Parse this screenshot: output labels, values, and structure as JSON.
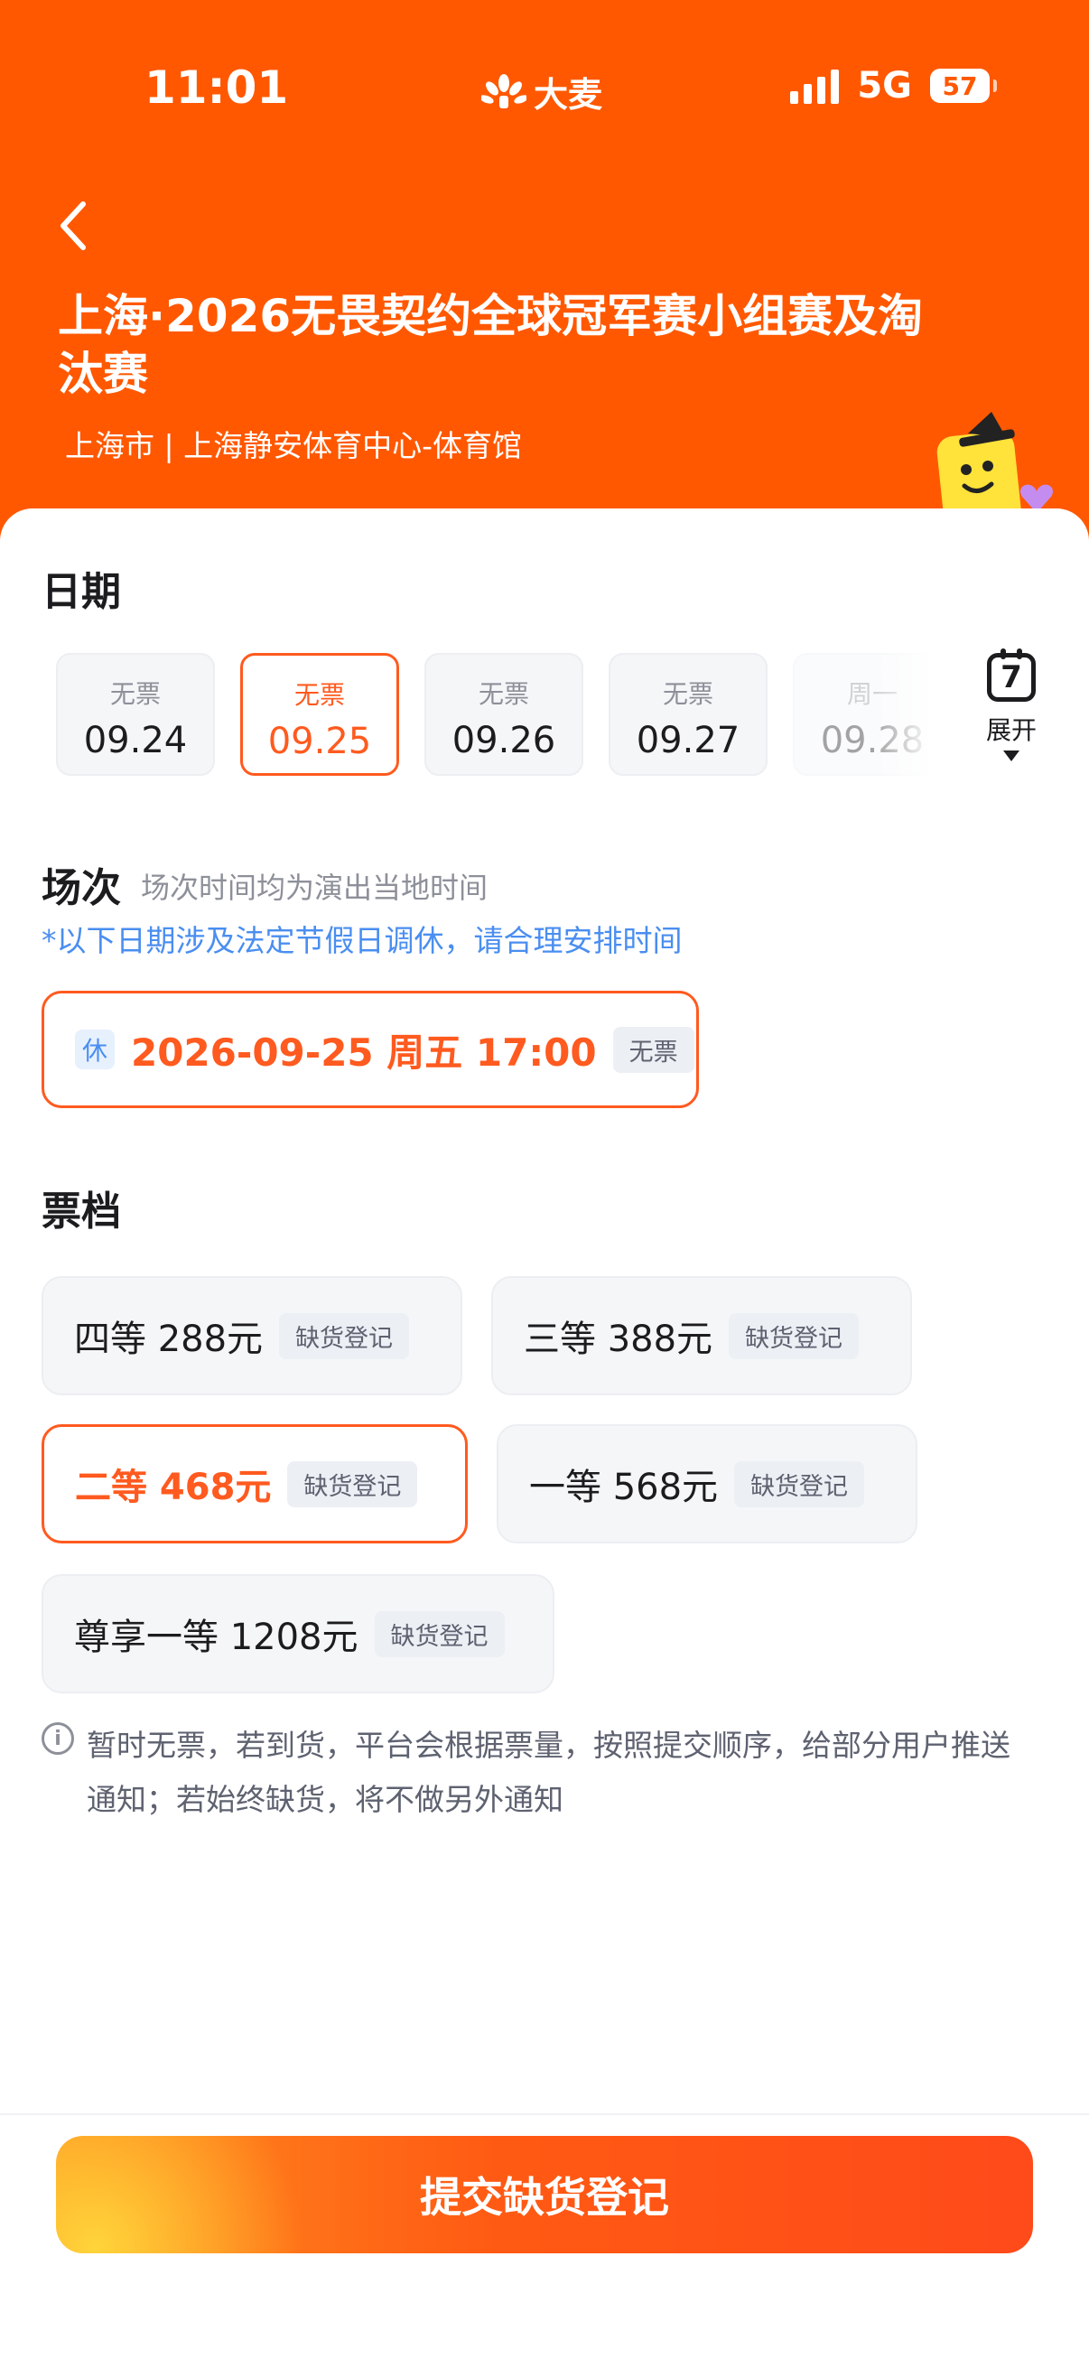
{
  "status_bar": {
    "time": "11:01",
    "app_logo": "大麦",
    "network": "5G",
    "battery": "57"
  },
  "header": {
    "title": "上海·2026无畏契约全球冠军赛小组赛及淘汰赛",
    "venue": "上海市 | 上海静安体育中心-体育馆"
  },
  "date_section": {
    "title": "日期",
    "dates": [
      {
        "status": "无票",
        "date": "09.24"
      },
      {
        "status": "无票",
        "date": "09.25"
      },
      {
        "status": "无票",
        "date": "09.26"
      },
      {
        "status": "无票",
        "date": "09.27"
      },
      {
        "status": "周一",
        "date": "09.28"
      }
    ],
    "selected_date": "09.25",
    "expand_icon_number": "7",
    "expand_label": "展开"
  },
  "session_section": {
    "title": "场次",
    "subtitle": "场次时间均为演出当地时间",
    "holiday_note": "*以下日期涉及法定节假日调休，请合理安排时间",
    "session": {
      "tag": "休",
      "text": "2026-09-25 周五 17:00",
      "status": "无票"
    }
  },
  "ticket_section": {
    "title": "票档",
    "tiers": [
      {
        "label": "四等 288元",
        "tag": "缺货登记"
      },
      {
        "label": "三等 388元",
        "tag": "缺货登记"
      },
      {
        "label": "二等 468元",
        "tag": "缺货登记"
      },
      {
        "label": "一等 568元",
        "tag": "缺货登记"
      },
      {
        "label": "尊享一等 1208元",
        "tag": "缺货登记"
      }
    ],
    "selected_tier": "二等 468元"
  },
  "notice": {
    "icon": "info-icon",
    "text": "暂时无票，若到货，平台会根据票量，按照提交顺序，给部分用户推送通知；若始终缺货，将不做另外通知"
  },
  "footer": {
    "submit_label": "提交缺货登记"
  },
  "colors": {
    "brand_orange": "#ff5800",
    "accent": "#ff5a1f",
    "link_blue": "#4a8ef0"
  }
}
